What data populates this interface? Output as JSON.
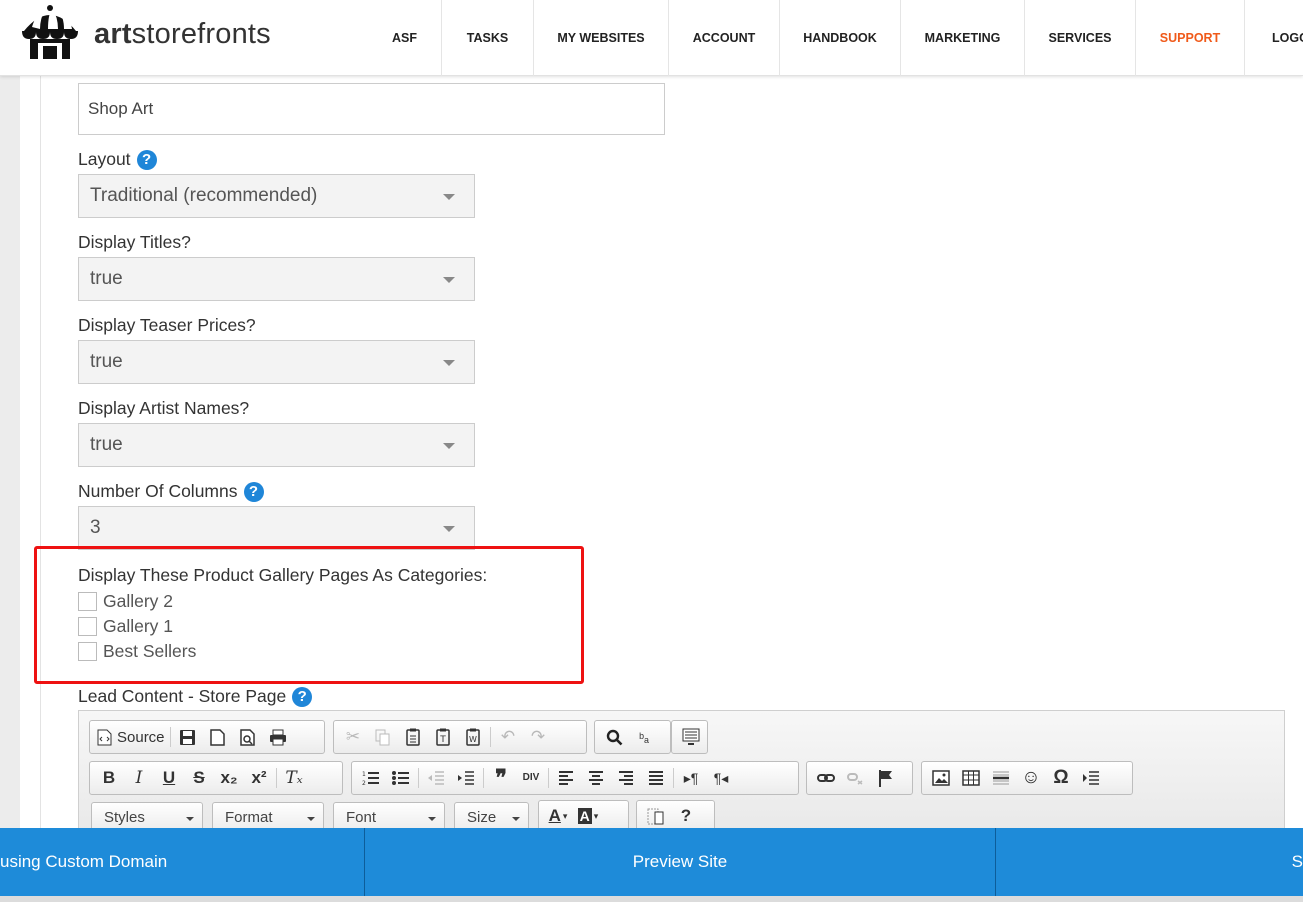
{
  "header": {
    "brand_bold": "art",
    "brand_rest": "storefronts",
    "nav": [
      {
        "label": "ASF"
      },
      {
        "label": "TASKS"
      },
      {
        "label": "MY WEBSITES"
      },
      {
        "label": "ACCOUNT"
      },
      {
        "label": "HANDBOOK"
      },
      {
        "label": "MARKETING"
      },
      {
        "label": "SERVICES"
      },
      {
        "label": "SUPPORT",
        "active": true
      },
      {
        "label": "LOGO"
      }
    ],
    "active_color": "#f05a1a"
  },
  "form": {
    "page_title_value": "Shop Art",
    "layout": {
      "label": "Layout",
      "value": "Traditional (recommended)"
    },
    "display_titles": {
      "label": "Display Titles?",
      "value": "true"
    },
    "display_teaser_prices": {
      "label": "Display Teaser Prices?",
      "value": "true"
    },
    "display_artist_names": {
      "label": "Display Artist Names?",
      "value": "true"
    },
    "number_of_columns": {
      "label": "Number Of Columns",
      "value": "3"
    },
    "categories": {
      "label": "Display These Product Gallery Pages As Categories:",
      "options": [
        {
          "label": "Gallery 2",
          "checked": false
        },
        {
          "label": "Gallery 1",
          "checked": false
        },
        {
          "label": "Best Sellers",
          "checked": false
        }
      ]
    },
    "lead_content": {
      "label": "Lead Content - Store Page"
    },
    "help_glyph": "?"
  },
  "editor": {
    "source_label": "Source",
    "styles_label": "Styles",
    "format_label": "Format",
    "font_label": "Font",
    "size_label": "Size",
    "help_glyph": "?"
  },
  "bottom_bar": {
    "left_label": "using Custom Domain",
    "middle_label": "Preview Site",
    "right_label": "S",
    "color": "#1e8bd9"
  }
}
